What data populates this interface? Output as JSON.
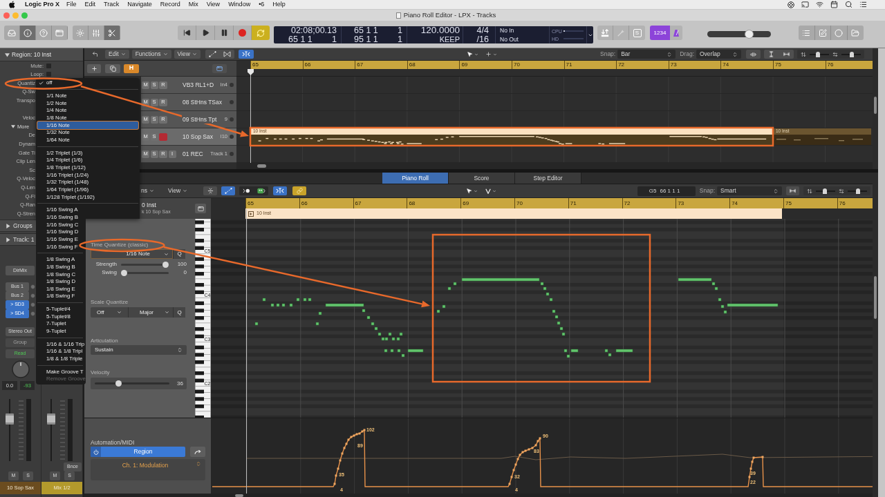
{
  "menu_bar": {
    "app": "Logic Pro X",
    "items": [
      "File",
      "Edit",
      "Track",
      "Navigate",
      "Record",
      "Mix",
      "View",
      "Window",
      "•6",
      "Help"
    ]
  },
  "window": {
    "title": "Piano Roll Editor - LPX - Tracks"
  },
  "control_bar": {
    "view_buttons": [
      {
        "selected": false
      },
      {
        "selected": true
      },
      {
        "selected": false
      },
      {
        "selected": false
      }
    ],
    "tool_buttons": [
      {
        "selected": false
      },
      {
        "selected": false
      },
      {
        "selected": true
      }
    ],
    "cycle": true,
    "lcd": {
      "smpte": "02:08;00.13",
      "position": "65 1 1",
      "position_tick": "1",
      "left_locator": "65 1 1",
      "left_tick": "1",
      "right_locator": "95 1 1",
      "right_tick": "1",
      "tempo": "120.0000",
      "tempo_mode": "KEEP",
      "signature": "4/4",
      "division": "/16",
      "midi_in": "No In",
      "midi_out": "No Out",
      "cpu_label": "CPU",
      "hd_label": "HD"
    },
    "solo_label": "S",
    "count_in": {
      "label": "1234",
      "on": true
    },
    "master_volume": {
      "level": 0.68
    }
  },
  "inspector": {
    "header": "Region: 10 Inst",
    "expanded": true,
    "rows": [
      {
        "label": "Mute:",
        "checked": false
      },
      {
        "label": "Loop:",
        "checked": false
      },
      {
        "label": "Quantiz"
      },
      {
        "label": "Q-Sw"
      },
      {
        "label": "Transpo"
      },
      {
        "label": "Veloc"
      }
    ],
    "more": {
      "label": "More",
      "expanded": true,
      "rows": [
        "De",
        "Dynam",
        "Gate Ti",
        "Clip Len",
        "Sc",
        "Q-Veloc",
        "Q-Len",
        "Q-Fl",
        "Q-Ran",
        "Q-Stren"
      ]
    },
    "sections": [
      {
        "label": "Groups",
        "expanded": false
      },
      {
        "label": "Track: 1",
        "expanded": false
      }
    ]
  },
  "mixer": {
    "strips": [
      {
        "input": "DirMix",
        "sends": [
          {
            "label": "Bus 1",
            "selected": false
          },
          {
            "label": "Bus 2",
            "selected": false
          },
          {
            "label": "> SD3",
            "selected": true
          },
          {
            "label": "> SD4",
            "selected": true
          }
        ],
        "output": "Stereo Out",
        "group": "Group",
        "automation": "Read",
        "volume": "0.0",
        "peak": "-93",
        "fader": {
          "level": 0.71
        },
        "mute": "M",
        "solo": "S",
        "name": "10 Sop Sax",
        "color": "#6b4c1f"
      },
      {
        "fader": {
          "level": 0.71
        },
        "bounce": "Bnce",
        "mute": "M",
        "solo": "S",
        "name": "Mix 1/2",
        "color": "#b39a2c"
      }
    ]
  },
  "quantize_menu": {
    "groups": [
      [
        {
          "label": "off",
          "checked": true,
          "selected": false,
          "disabled": false
        }
      ],
      [
        {
          "label": "1/1 Note",
          "checked": false,
          "selected": false,
          "disabled": false
        },
        {
          "label": "1/2 Note",
          "checked": false,
          "selected": false,
          "disabled": false
        },
        {
          "label": "1/4 Note",
          "checked": false,
          "selected": false,
          "disabled": false
        },
        {
          "label": "1/8 Note",
          "checked": false,
          "selected": false,
          "disabled": false
        },
        {
          "label": "1/16 Note",
          "checked": false,
          "selected": true,
          "disabled": false
        },
        {
          "label": "1/32 Note",
          "checked": false,
          "selected": false,
          "disabled": false
        },
        {
          "label": "1/64 Note",
          "checked": false,
          "selected": false,
          "disabled": false
        }
      ],
      [
        {
          "label": "1/2 Triplet (1/3)",
          "checked": false,
          "selected": false,
          "disabled": false
        },
        {
          "label": "1/4 Triplet (1/6)",
          "checked": false,
          "selected": false,
          "disabled": false
        },
        {
          "label": "1/8 Triplet (1/12)",
          "checked": false,
          "selected": false,
          "disabled": false
        },
        {
          "label": "1/16 Triplet (1/24)",
          "checked": false,
          "selected": false,
          "disabled": false
        },
        {
          "label": "1/32 Triplet (1/48)",
          "checked": false,
          "selected": false,
          "disabled": false
        },
        {
          "label": "1/64 Triplet (1/96)",
          "checked": false,
          "selected": false,
          "disabled": false
        },
        {
          "label": "1/128 Triplet (1/192)",
          "checked": false,
          "selected": false,
          "disabled": false
        }
      ],
      [
        {
          "label": "1/16 Swing A",
          "checked": false,
          "selected": false,
          "disabled": false
        },
        {
          "label": "1/16 Swing B",
          "checked": false,
          "selected": false,
          "disabled": false
        },
        {
          "label": "1/16 Swing C",
          "checked": false,
          "selected": false,
          "disabled": false
        },
        {
          "label": "1/16 Swing D",
          "checked": false,
          "selected": false,
          "disabled": false
        },
        {
          "label": "1/16 Swing E",
          "checked": false,
          "selected": false,
          "disabled": false
        },
        {
          "label": "1/16 Swing F",
          "checked": false,
          "selected": false,
          "disabled": false
        }
      ],
      [
        {
          "label": "1/8 Swing A",
          "checked": false,
          "selected": false,
          "disabled": false
        },
        {
          "label": "1/8 Swing B",
          "checked": false,
          "selected": false,
          "disabled": false
        },
        {
          "label": "1/8 Swing C",
          "checked": false,
          "selected": false,
          "disabled": false
        },
        {
          "label": "1/8 Swing D",
          "checked": false,
          "selected": false,
          "disabled": false
        },
        {
          "label": "1/8 Swing E",
          "checked": false,
          "selected": false,
          "disabled": false
        },
        {
          "label": "1/8 Swing F",
          "checked": false,
          "selected": false,
          "disabled": false
        }
      ],
      [
        {
          "label": "5-Tuplet/4",
          "checked": false,
          "selected": false,
          "disabled": false
        },
        {
          "label": "5-Tuplet/8",
          "checked": false,
          "selected": false,
          "disabled": false
        },
        {
          "label": "7-Tuplet",
          "checked": false,
          "selected": false,
          "disabled": false
        },
        {
          "label": "9-Tuplet",
          "checked": false,
          "selected": false,
          "disabled": false
        }
      ],
      [
        {
          "label": "1/16 & 1/16 Trip",
          "checked": false,
          "selected": false,
          "disabled": false
        },
        {
          "label": "1/16 & 1/8 Tripl",
          "checked": false,
          "selected": false,
          "disabled": false
        },
        {
          "label": "1/8 & 1/8 Triple",
          "checked": false,
          "selected": false,
          "disabled": false
        }
      ],
      [
        {
          "label": "Make Groove T",
          "checked": false,
          "selected": false,
          "disabled": false
        },
        {
          "label": "Remove Groove",
          "checked": false,
          "selected": false,
          "disabled": true
        }
      ]
    ]
  },
  "tracks_area": {
    "toolbar": {
      "menus": [
        "Edit",
        "Functions",
        "View"
      ],
      "catch": true,
      "snap_label": "Snap:",
      "snap": "Bar",
      "drag_label": "Drag:",
      "drag": "Overlap",
      "vertical_zoom": {
        "level": 0.4
      },
      "horizontal_zoom": {
        "level": 0.55
      }
    },
    "hide": {
      "label": "H",
      "on": true
    },
    "ruler": [
      "65",
      "66",
      "67",
      "68",
      "69",
      "70",
      "71",
      "72",
      "73",
      "74",
      "75",
      "76"
    ],
    "tracks": [
      {
        "name": "VB3 RL1+D",
        "label": "In4",
        "selected": false,
        "buttons": [
          {
            "kind": "toggle",
            "label": "M"
          },
          {
            "kind": "toggle",
            "label": "S"
          },
          {
            "kind": "record",
            "label": "R",
            "on": false
          }
        ]
      },
      {
        "name": "08 StHns TSax",
        "selected": false,
        "buttons": [
          {
            "kind": "toggle",
            "label": "M"
          },
          {
            "kind": "toggle",
            "label": "S"
          },
          {
            "kind": "record",
            "label": "R",
            "on": false
          }
        ]
      },
      {
        "name": "09 StHns Tpt",
        "label": "9",
        "selected": false,
        "buttons": [
          {
            "kind": "toggle",
            "label": "M"
          },
          {
            "kind": "toggle",
            "label": "S"
          },
          {
            "kind": "record",
            "label": "R",
            "on": false
          }
        ]
      },
      {
        "name": "10 Sop Sax",
        "label": "I10",
        "selected": true,
        "buttons": [
          {
            "kind": "toggle",
            "label": "M"
          },
          {
            "kind": "toggle",
            "label": "S"
          },
          {
            "kind": "record",
            "on": true
          }
        ],
        "regions": [
          {
            "name": "10 Inst",
            "selected": true
          },
          {
            "name": "10 Inst",
            "selected": false
          }
        ]
      },
      {
        "name": "01 REC",
        "label": "Track 1",
        "selected": false,
        "buttons": [
          {
            "kind": "toggle",
            "label": "M"
          },
          {
            "kind": "toggle",
            "label": "S"
          },
          {
            "kind": "record",
            "label": "R",
            "on": false
          },
          {
            "kind": "toggle",
            "label": "I"
          }
        ]
      }
    ]
  },
  "piano_roll": {
    "tabs": [
      {
        "label": "Piano Roll",
        "selected": true
      },
      {
        "label": "Score",
        "selected": false
      },
      {
        "label": "Step Editor",
        "selected": false
      }
    ],
    "toolbar": {
      "menus": [
        "ns",
        "View"
      ],
      "catch": true,
      "link": true,
      "pitch": "G5",
      "position": "66 1 1 1",
      "snap_label": "Snap:",
      "snap": "Smart",
      "vertical_zoom": {
        "level": 0.45
      },
      "horizontal_zoom": {
        "level": 0.55
      }
    },
    "region_name": "0 Inst",
    "track_name": "k 10 Sop Sax",
    "ruler": [
      "65",
      "66",
      "67",
      "68",
      "69",
      "70",
      "71",
      "72",
      "73",
      "74",
      "75",
      "76"
    ],
    "region": "10 Inst",
    "time_quantize": {
      "title": "Time Quantize (classic)",
      "value": "1/16 Note",
      "q": "Q",
      "strength": {
        "label": "Strength",
        "level": 1,
        "reading": "100"
      },
      "swing": {
        "label": "Swing",
        "level": 0,
        "reading": "0"
      }
    },
    "scale_quantize": {
      "title": "Scale Quantize",
      "mode": "Off",
      "scale": "Major",
      "q": "Q"
    },
    "articulation": {
      "title": "Articulation",
      "value": "Sustain"
    },
    "velocity": {
      "title": "Velocity",
      "level": 0.3,
      "reading": "36"
    },
    "keys": [
      "C5",
      "C4",
      "C3",
      "C2"
    ],
    "automation": {
      "label": "Automation/MIDI",
      "mode": "Region",
      "mode_on": true,
      "parameter": "Ch. 1: Modulation",
      "point_labels": [
        "102",
        "89",
        "35",
        "4",
        "90",
        "83",
        "32",
        "4",
        "39",
        "22"
      ]
    }
  }
}
